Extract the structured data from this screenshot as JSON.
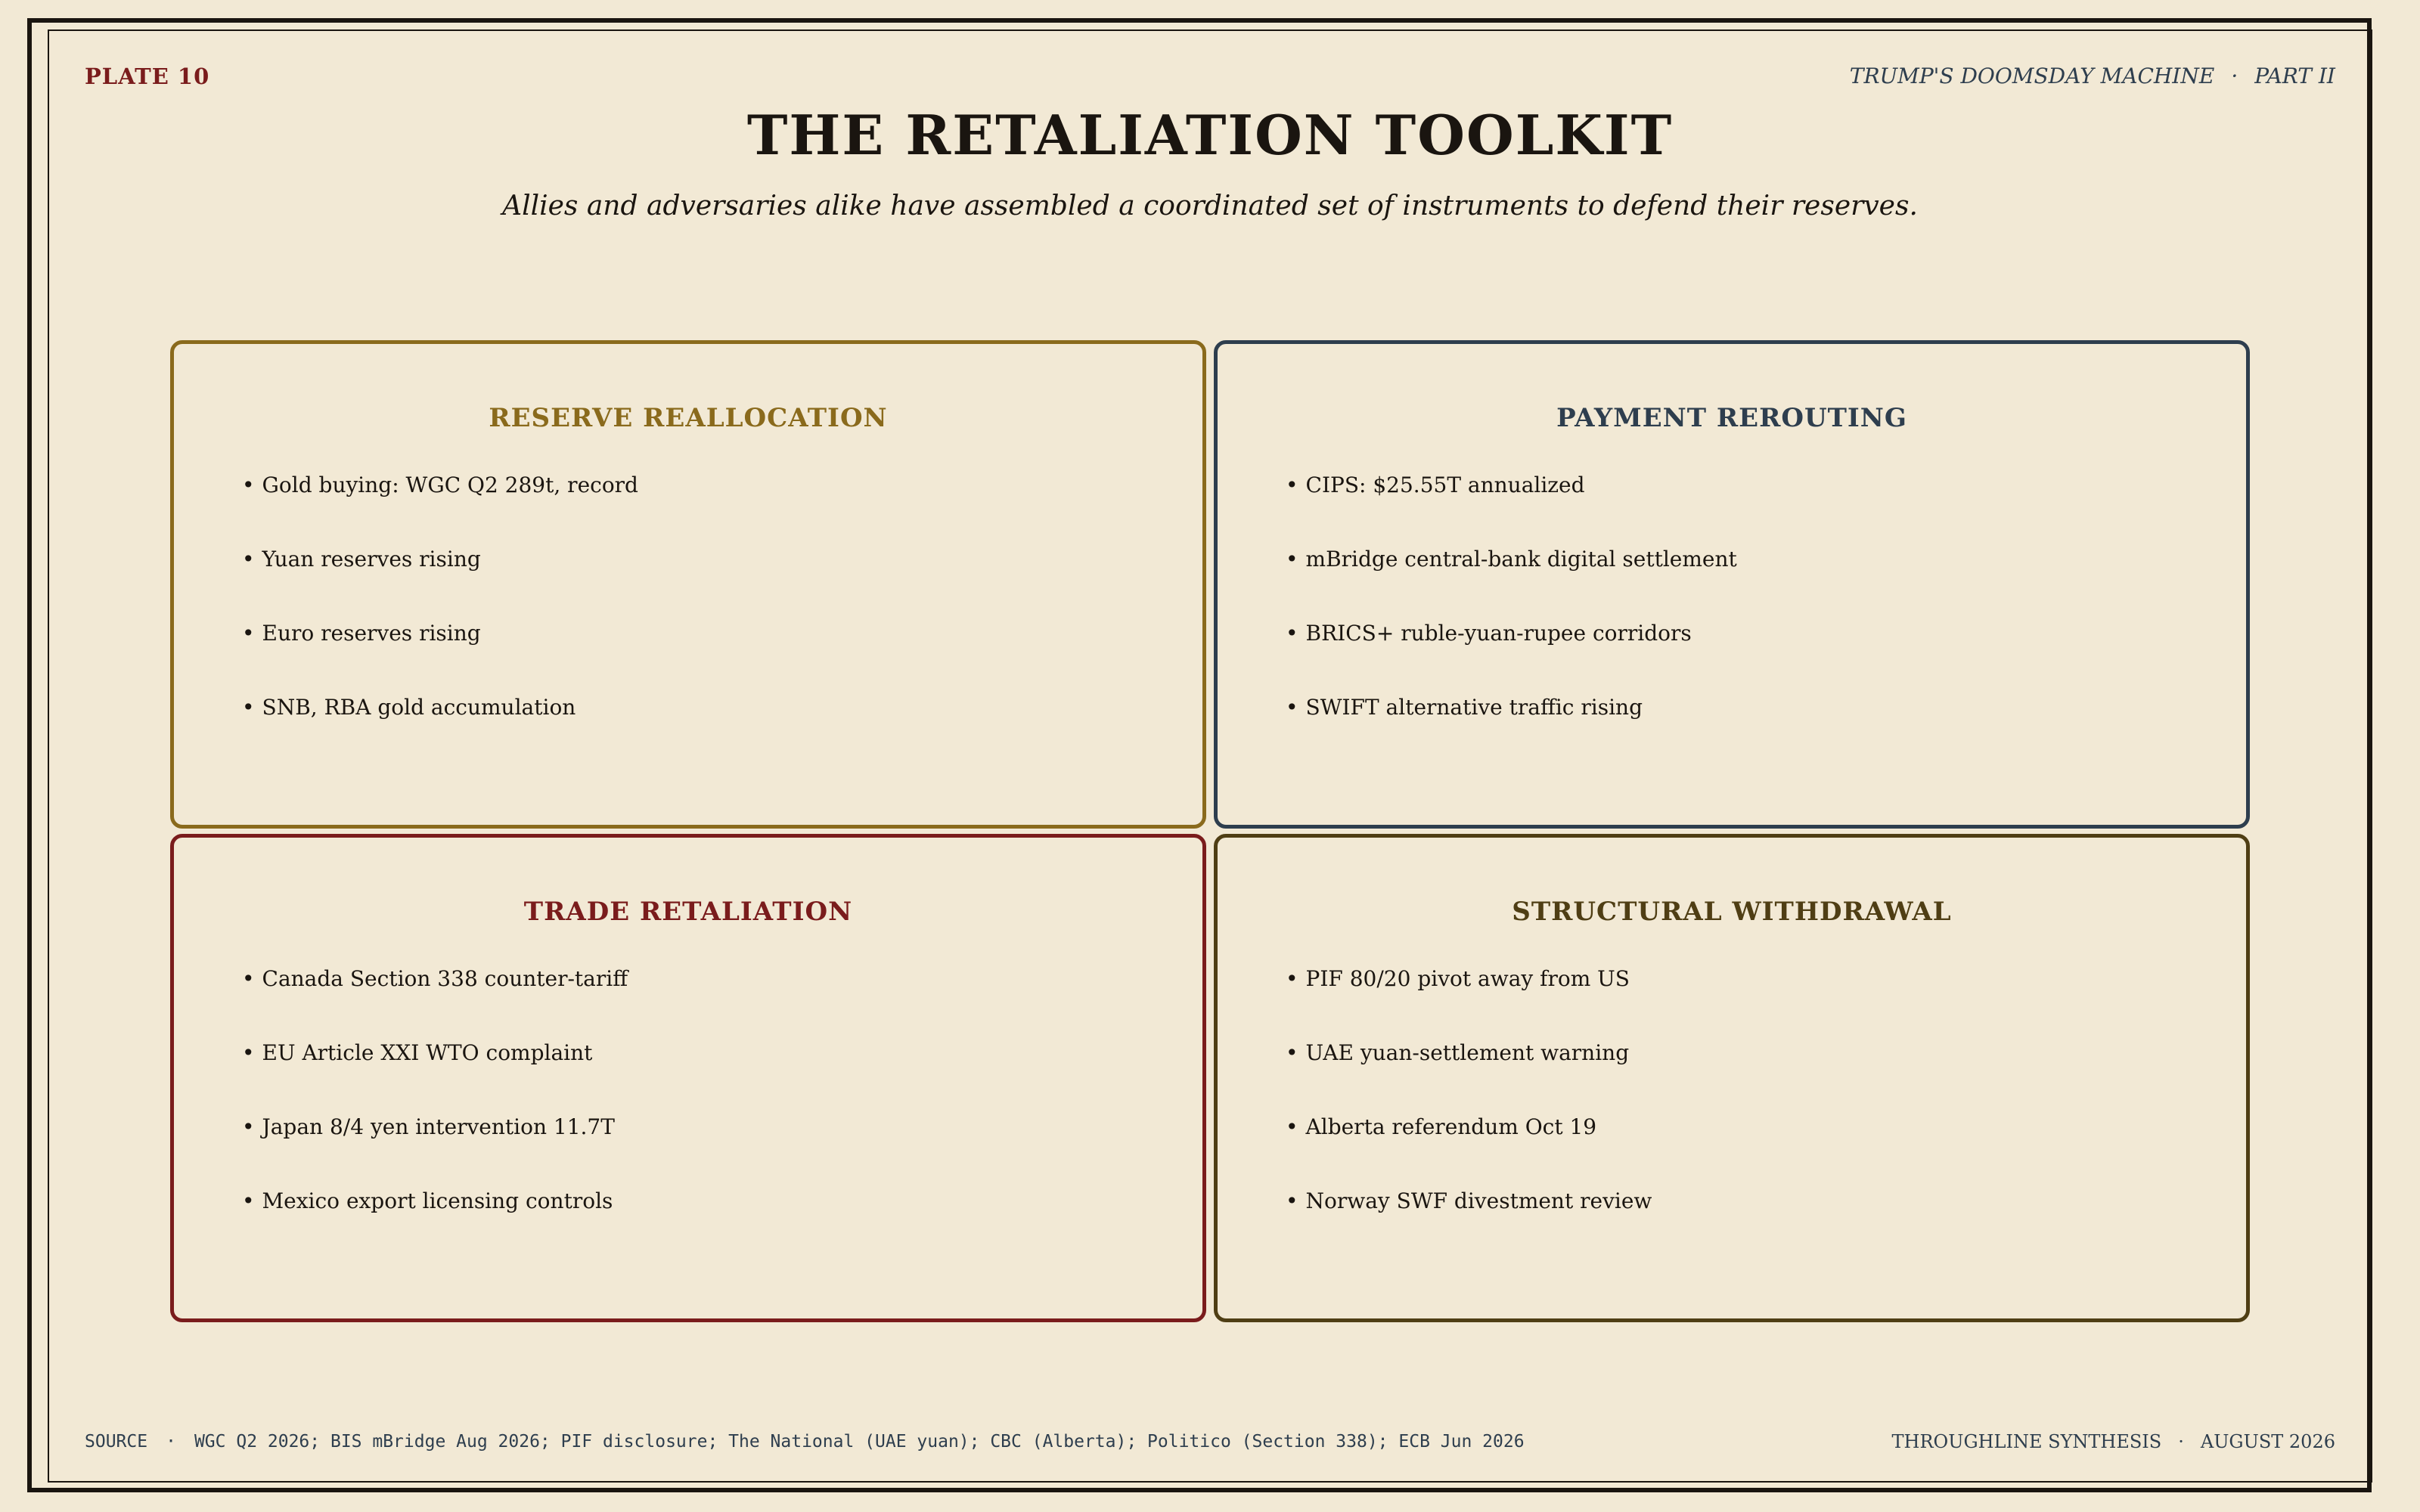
{
  "header": {
    "plate_label": "PLATE 10",
    "series_title": "TRUMP'S DOOMSDAY MACHINE",
    "series_sep": "·",
    "series_part": "PART II"
  },
  "title": "THE RETALIATION TOOLKIT",
  "subtitle": "Allies and adversaries alike have assembled a coordinated set of instruments to defend their reserves.",
  "bullet_glyph": "•",
  "panels": [
    {
      "title": "RESERVE REALLOCATION",
      "color": "#8a6a1c",
      "items": [
        "Gold buying: WGC Q2 289t, record",
        "Yuan reserves rising",
        "Euro reserves rising",
        "SNB, RBA gold accumulation"
      ]
    },
    {
      "title": "PAYMENT REROUTING",
      "color": "#2e3e4e",
      "items": [
        "CIPS: $25.55T annualized",
        "mBridge central-bank digital settlement",
        "BRICS+ ruble-yuan-rupee corridors",
        "SWIFT alternative traffic rising"
      ]
    },
    {
      "title": "TRADE RETALIATION",
      "color": "#7a1c1c",
      "items": [
        "Canada Section 338 counter-tariff",
        "EU Article XXI WTO complaint",
        "Japan 8/4 yen intervention 11.7T",
        "Mexico export licensing controls"
      ]
    },
    {
      "title": "STRUCTURAL WITHDRAWAL",
      "color": "#4f3e14",
      "items": [
        "PIF 80/20 pivot away from US",
        "UAE yuan-settlement warning",
        "Alberta referendum Oct 19",
        "Norway SWF divestment review"
      ]
    }
  ],
  "footer": {
    "source_label": "SOURCE",
    "source_sep": "·",
    "source_text": "WGC Q2 2026; BIS mBridge Aug 2026; PIF disclosure; The National (UAE yuan); CBC (Alberta); Politico (Section 338); ECB Jun 2026",
    "credit_name": "THROUGHLINE SYNTHESIS",
    "credit_sep": "·",
    "credit_date": "AUGUST 2026"
  }
}
